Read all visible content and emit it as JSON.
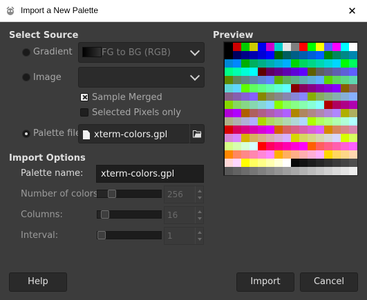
{
  "window": {
    "title": "Import a New Palette",
    "close_glyph": "✕",
    "app_icon": "gimp-icon"
  },
  "source": {
    "heading": "Select Source",
    "gradient": {
      "label": "Gradient",
      "value": "FG to BG (RGB)",
      "selected": false
    },
    "image": {
      "label": "Image",
      "value": "",
      "selected": false
    },
    "sample_merged": {
      "label": "Sample Merged",
      "checked": true
    },
    "selected_pixels": {
      "label": "Selected Pixels only",
      "checked": false
    },
    "palette_file": {
      "label": "Palette file",
      "value": "xterm-colors.gpl",
      "selected": true
    }
  },
  "options": {
    "heading": "Import Options",
    "palette_name": {
      "label": "Palette name:",
      "value": "xterm-colors.gpl"
    },
    "num_colors": {
      "label": "Number of colors:",
      "value": "256",
      "fraction": 0.19
    },
    "columns": {
      "label": "Columns:",
      "value": "16",
      "fraction": 0.06
    },
    "interval": {
      "label": "Interval:",
      "value": "1",
      "fraction": 0.0
    }
  },
  "preview": {
    "heading": "Preview",
    "colors": [
      "#000000",
      "#cd0000",
      "#00cd00",
      "#cdcd00",
      "#0000ee",
      "#cd00cd",
      "#00cdcd",
      "#e5e5e5",
      "#7f7f7f",
      "#ff0000",
      "#00ff00",
      "#ffff00",
      "#5c5cff",
      "#ff00ff",
      "#00ffff",
      "#ffffff",
      "#000000",
      "#00005f",
      "#000087",
      "#0000af",
      "#0000d7",
      "#0000ff",
      "#005f00",
      "#005f5f",
      "#005f87",
      "#005faf",
      "#005fd7",
      "#005fff",
      "#008700",
      "#00875f",
      "#008787",
      "#0087af",
      "#0087d7",
      "#0087ff",
      "#00af00",
      "#00af5f",
      "#00af87",
      "#00afaf",
      "#00afd7",
      "#00afff",
      "#00d700",
      "#00d75f",
      "#00d787",
      "#00d7af",
      "#00d7d7",
      "#00d7ff",
      "#00ff00",
      "#00ff5f",
      "#00ff87",
      "#00ffaf",
      "#00ffd7",
      "#00ffff",
      "#5f0000",
      "#5f005f",
      "#5f0087",
      "#5f00af",
      "#5f00d7",
      "#5f00ff",
      "#5f5f00",
      "#5f5f5f",
      "#5f5f87",
      "#5f5faf",
      "#5f5fd7",
      "#5f5fff",
      "#5f8700",
      "#5f875f",
      "#5f8787",
      "#5f87af",
      "#5f87d7",
      "#5f87ff",
      "#5faf00",
      "#5faf5f",
      "#5faf87",
      "#5fafaf",
      "#5fafd7",
      "#5fafff",
      "#5fd700",
      "#5fd75f",
      "#5fd787",
      "#5fd7af",
      "#5fd7d7",
      "#5fd7ff",
      "#5fff00",
      "#5fff5f",
      "#5fff87",
      "#5fffaf",
      "#5fffd7",
      "#5fffff",
      "#870000",
      "#87005f",
      "#870087",
      "#8700af",
      "#8700d7",
      "#8700ff",
      "#875f00",
      "#875f5f",
      "#875f87",
      "#875faf",
      "#875fd7",
      "#875fff",
      "#878700",
      "#87875f",
      "#878787",
      "#8787af",
      "#8787d7",
      "#8787ff",
      "#87af00",
      "#87af5f",
      "#87af87",
      "#87afaf",
      "#87afd7",
      "#87afff",
      "#87d700",
      "#87d75f",
      "#87d787",
      "#87d7af",
      "#87d7d7",
      "#87d7ff",
      "#87ff00",
      "#87ff5f",
      "#87ff87",
      "#87ffaf",
      "#87ffd7",
      "#87ffff",
      "#af0000",
      "#af005f",
      "#af0087",
      "#af00af",
      "#af00d7",
      "#af00ff",
      "#af5f00",
      "#af5f5f",
      "#af5f87",
      "#af5faf",
      "#af5fd7",
      "#af5fff",
      "#af8700",
      "#af875f",
      "#af8787",
      "#af87af",
      "#af87d7",
      "#af87ff",
      "#afaf00",
      "#afaf5f",
      "#afaf87",
      "#afafaf",
      "#afafd7",
      "#afafff",
      "#afd700",
      "#afd75f",
      "#afd787",
      "#afd7af",
      "#afd7d7",
      "#afd7ff",
      "#afff00",
      "#afff5f",
      "#afff87",
      "#afffaf",
      "#afffd7",
      "#afffff",
      "#d70000",
      "#d7005f",
      "#d70087",
      "#d700af",
      "#d700d7",
      "#d700ff",
      "#d75f00",
      "#d75f5f",
      "#d75f87",
      "#d75faf",
      "#d75fd7",
      "#d75fff",
      "#d78700",
      "#d7875f",
      "#d78787",
      "#d787af",
      "#d787d7",
      "#d787ff",
      "#d7af00",
      "#d7af5f",
      "#d7af87",
      "#d7afaf",
      "#d7afd7",
      "#d7afff",
      "#d7d700",
      "#d7d75f",
      "#d7d787",
      "#d7d7af",
      "#d7d7d7",
      "#d7d7ff",
      "#d7ff00",
      "#d7ff5f",
      "#d7ff87",
      "#d7ffaf",
      "#d7ffd7",
      "#d7ffff",
      "#ff0000",
      "#ff005f",
      "#ff0087",
      "#ff00af",
      "#ff00d7",
      "#ff00ff",
      "#ff5f00",
      "#ff5f5f",
      "#ff5f87",
      "#ff5faf",
      "#ff5fd7",
      "#ff5fff",
      "#ff8700",
      "#ff875f",
      "#ff8787",
      "#ff87af",
      "#ff87d7",
      "#ff87ff",
      "#ffaf00",
      "#ffaf5f",
      "#ffaf87",
      "#ffafaf",
      "#ffafd7",
      "#ffafff",
      "#ffd700",
      "#ffd75f",
      "#ffd787",
      "#ffd7af",
      "#ffd7d7",
      "#ffd7ff",
      "#ffff00",
      "#ffff5f",
      "#ffff87",
      "#ffffaf",
      "#ffffd7",
      "#ffffff",
      "#080808",
      "#121212",
      "#1c1c1c",
      "#262626",
      "#303030",
      "#3a3a3a",
      "#444444",
      "#4e4e4e",
      "#585858",
      "#626262",
      "#6c6c6c",
      "#767676",
      "#808080",
      "#8a8a8a",
      "#949494",
      "#9e9e9e",
      "#a8a8a8",
      "#b2b2b2",
      "#bcbcbc",
      "#c6c6c6",
      "#d0d0d0",
      "#dadada",
      "#e4e4e4",
      "#eeeeee"
    ]
  },
  "buttons": {
    "help": "Help",
    "import": "Import",
    "cancel": "Cancel"
  }
}
